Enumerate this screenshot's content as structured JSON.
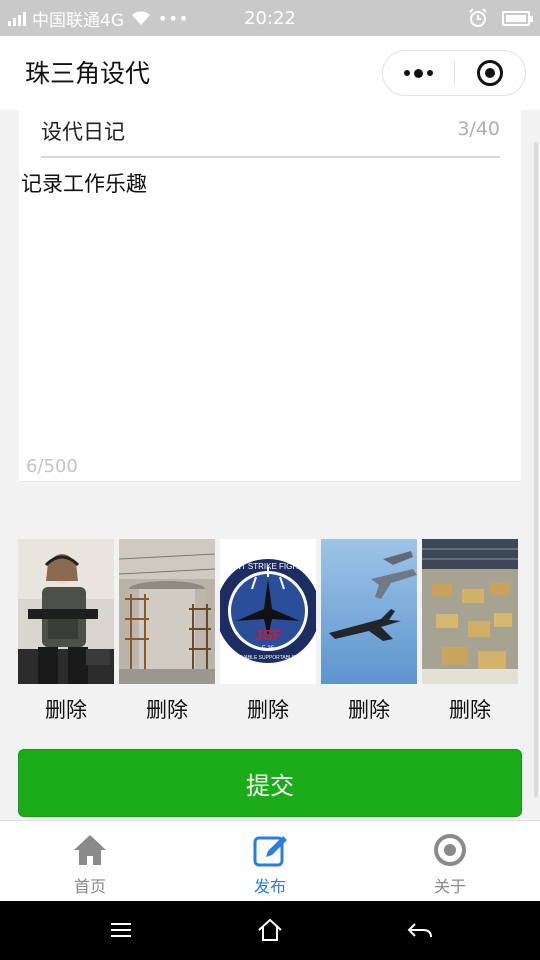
{
  "status_bar": {
    "carrier": "中国联通4G",
    "time": "20:22",
    "signal_label": "4G"
  },
  "titlebar": {
    "title": "珠三角设代"
  },
  "form": {
    "title_value": "设代日记",
    "title_count": "3/40",
    "content_value": "记录工作乐趣",
    "content_count": "6/500"
  },
  "images": [
    {
      "name": "soldier-photo",
      "delete_label": "删除"
    },
    {
      "name": "construction-photo",
      "delete_label": "删除"
    },
    {
      "name": "jsf-f35-badge",
      "delete_label": "删除"
    },
    {
      "name": "fighter-jets-photo",
      "delete_label": "删除"
    },
    {
      "name": "factory-photo",
      "delete_label": "删除"
    }
  ],
  "badge_text": {
    "top": "INT STRIKE FIGHT",
    "brand": "JSF",
    "model": "F-35",
    "bottom": "RVIVABLE  SUPPORTABLE  AF"
  },
  "submit_label": "提交",
  "tabs": [
    {
      "label": "首页",
      "icon": "home-icon",
      "active": false
    },
    {
      "label": "发布",
      "icon": "edit-icon",
      "active": true
    },
    {
      "label": "关于",
      "icon": "about-icon",
      "active": false
    }
  ],
  "colors": {
    "accent": "#1aad19",
    "tab_active": "#2a7ee0",
    "tab_inactive": "#8a8a8a"
  }
}
